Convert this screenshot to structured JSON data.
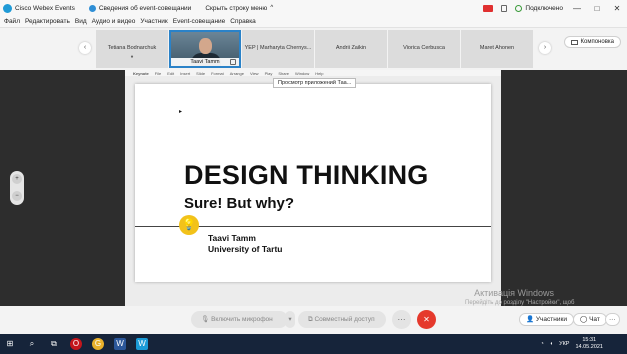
{
  "window": {
    "app_title": "Cisco Webex Events",
    "meeting_info": "Сведения об event-совещании",
    "hide_menu": "Скрыть строку меню",
    "hide_menu_chevron": "^",
    "connection": "Подключено",
    "win_minimize": "—",
    "win_restore": "□",
    "win_close": "✕"
  },
  "menubar": {
    "items": [
      "Файл",
      "Редактировать",
      "Вид",
      "Аудио и видео",
      "Участник",
      "Event-совещание",
      "Справка"
    ]
  },
  "participants": {
    "prev_arrow": "‹",
    "next_arrow": "›",
    "tiles": [
      {
        "name": "Tetiana Bodnarchuk",
        "sub": "●"
      },
      {
        "name": "Taavi Tamm",
        "video": true
      },
      {
        "name": "YEP | Marharyta Chernys..."
      },
      {
        "name": "Andrii Zaikin"
      },
      {
        "name": "Viorica Cerbusca"
      },
      {
        "name": "Maret Ahonen"
      }
    ],
    "layout_button": "Компоновка"
  },
  "share": {
    "mac_menu": [
      "Keynote",
      "File",
      "Edit",
      "Insert",
      "Slide",
      "Format",
      "Arrange",
      "View",
      "Play",
      "Share",
      "Window",
      "Help"
    ],
    "viewer_tag": "Просмотр приложений Таа...",
    "slide": {
      "title": "DESIGN THINKING",
      "subtitle": "Sure! But why?",
      "author": "Taavi Tamm",
      "affiliation": "University of Tartu",
      "bulb_icon": "💡",
      "cursor_icon": "▸"
    },
    "zoom_in": "+",
    "zoom_out": "−"
  },
  "controls": {
    "mic_button": "Включить микрофон",
    "mic_dropdown": "▾",
    "share_button": "Совместный доступ",
    "more_button": "···",
    "leave_button": "✕",
    "participants_button": "Участники",
    "chat_button": "Чат",
    "side_more": "···"
  },
  "watermark": {
    "title": "Активація Windows",
    "subtitle": "Перейдіть до розділу \"Настройки\", щоб активувати Windows."
  },
  "taskbar": {
    "icons": [
      "⊞",
      "⌕",
      "⧉",
      "O",
      "G",
      "W",
      "W"
    ],
    "lang": "УКР",
    "time": "15:31",
    "date": "14.05.2021"
  },
  "colors": {
    "accent": "#2a82c8",
    "leave": "#e5392c",
    "taskbar": "#16243a"
  }
}
